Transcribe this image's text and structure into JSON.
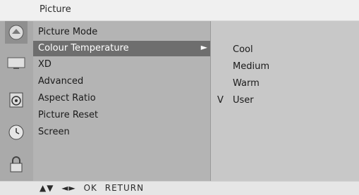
{
  "header": {
    "title": "Picture"
  },
  "sidebar": {
    "icons": [
      {
        "name": "picture-icon",
        "selected": true
      },
      {
        "name": "screen-icon"
      },
      {
        "name": "audio-speaker-icon"
      },
      {
        "name": "clock-icon"
      },
      {
        "name": "lock-icon"
      }
    ]
  },
  "menu": {
    "items": [
      {
        "label": "Picture Mode"
      },
      {
        "label": "Colour Temperature",
        "active": true
      },
      {
        "label": "XD"
      },
      {
        "label": "Advanced"
      },
      {
        "label": "Aspect Ratio"
      },
      {
        "label": "Picture Reset"
      },
      {
        "label": "Screen"
      }
    ],
    "active_arrow": "►"
  },
  "submenu": {
    "items": [
      {
        "label": "Cool"
      },
      {
        "label": "Medium"
      },
      {
        "label": "Warm"
      },
      {
        "label": "User",
        "mark": "V"
      }
    ]
  },
  "footer": {
    "nav_keys": "▲▼",
    "lr_keys": "◄►",
    "ok": "OK",
    "return": "RETURN"
  }
}
